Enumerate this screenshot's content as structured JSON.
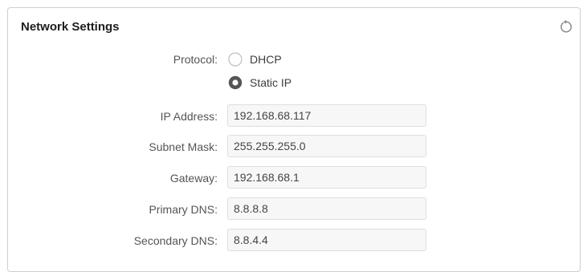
{
  "panel": {
    "title": "Network Settings",
    "reset_icon": "reset-icon"
  },
  "protocol": {
    "label": "Protocol:",
    "options": [
      {
        "label": "DHCP",
        "selected": false
      },
      {
        "label": "Static IP",
        "selected": true
      }
    ]
  },
  "fields": {
    "ip_address": {
      "label": "IP Address:",
      "value": "192.168.68.117"
    },
    "subnet_mask": {
      "label": "Subnet Mask:",
      "value": "255.255.255.0"
    },
    "gateway": {
      "label": "Gateway:",
      "value": "192.168.68.1"
    },
    "primary_dns": {
      "label": "Primary DNS:",
      "value": "8.8.8.8"
    },
    "secondary_dns": {
      "label": "Secondary DNS:",
      "value": "8.8.4.4"
    }
  }
}
